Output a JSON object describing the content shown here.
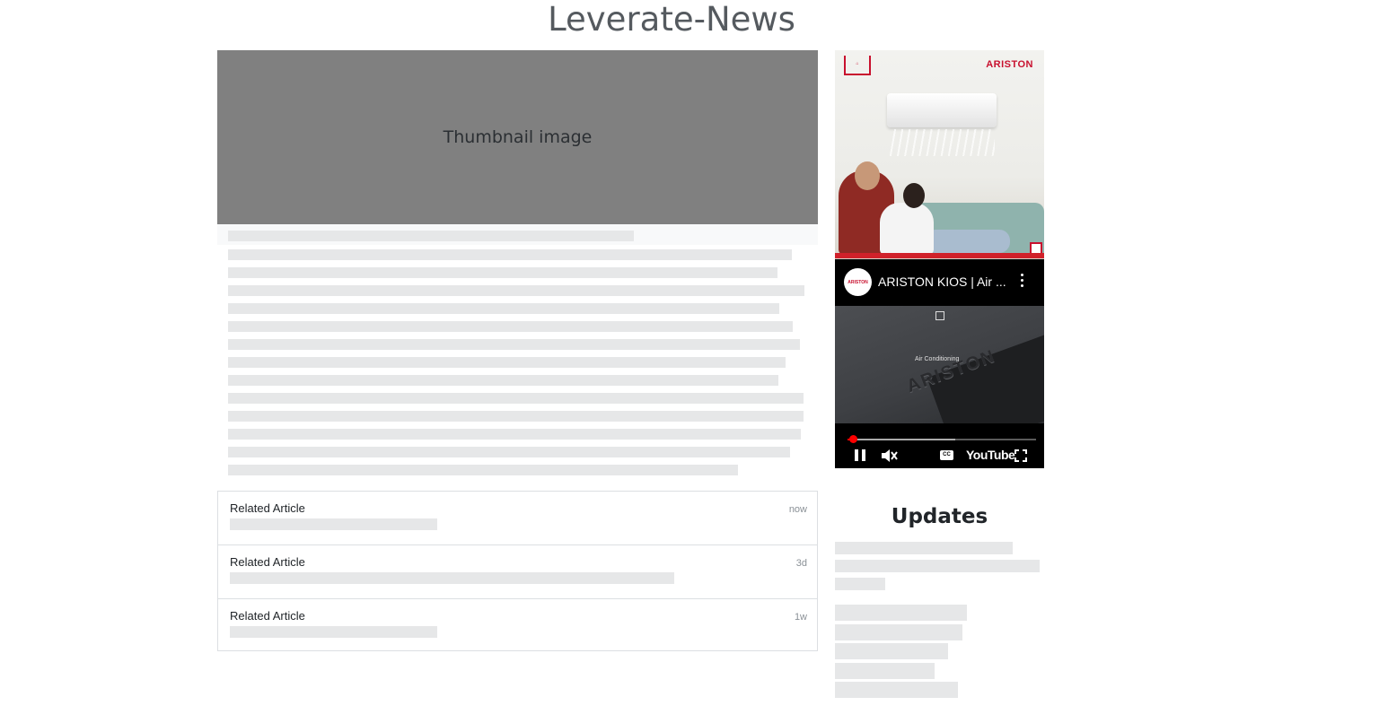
{
  "site": {
    "title": "Leverate-News"
  },
  "article": {
    "thumbnail_label": "Thumbnail image"
  },
  "related": {
    "items": [
      {
        "title": "Related Article",
        "time": "now"
      },
      {
        "title": "Related Article",
        "time": "3d"
      },
      {
        "title": "Related Article",
        "time": "1w"
      }
    ]
  },
  "ad": {
    "brand": "ARISTON",
    "video_title": "ARISTON KIOS | Air ...",
    "caption": "Air Conditioning",
    "cc_label": "CC",
    "player_logo": "YouTube",
    "progress": 0.03,
    "buffered": 0.57,
    "accent_color": "#ff0000",
    "icons": [
      "kebab-menu-icon",
      "pause-icon",
      "mute-icon",
      "cc-icon",
      "fullscreen-icon"
    ]
  },
  "sidebar": {
    "updates_title": "Updates"
  },
  "colors": {
    "title": "#555a5f",
    "thumbnail_bg": "#808080",
    "skeleton": "#e6e7e8",
    "brand_red": "#c8102e"
  }
}
